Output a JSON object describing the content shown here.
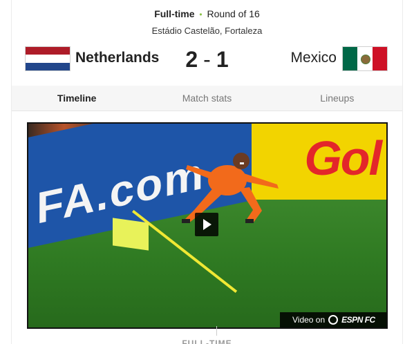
{
  "match": {
    "status": "Full-time",
    "separator": "•",
    "round": "Round of 16",
    "venue": "Estádio Castelão, Fortaleza",
    "home_team": "Netherlands",
    "away_team": "Mexico",
    "home_score": "2",
    "score_separator": "-",
    "away_score": "1"
  },
  "flags": {
    "home_colors": [
      "#ae1c28",
      "#ffffff",
      "#21468b"
    ],
    "away_colors": [
      "#006847",
      "#ffffff",
      "#ce1126"
    ]
  },
  "tabs": [
    {
      "label": "Timeline",
      "active": true
    },
    {
      "label": "Match stats",
      "active": false
    },
    {
      "label": "Lineups",
      "active": false
    }
  ],
  "video": {
    "board_text": "FA.com",
    "board_red_text": "Gol",
    "provider_prefix": "Video on",
    "provider_name": "ESPN FC"
  },
  "timeline": {
    "first_label": "FULL-TIME"
  },
  "colors": {
    "accent_green": "#8bc34a",
    "tab_bar_bg": "#f6f6f6"
  }
}
